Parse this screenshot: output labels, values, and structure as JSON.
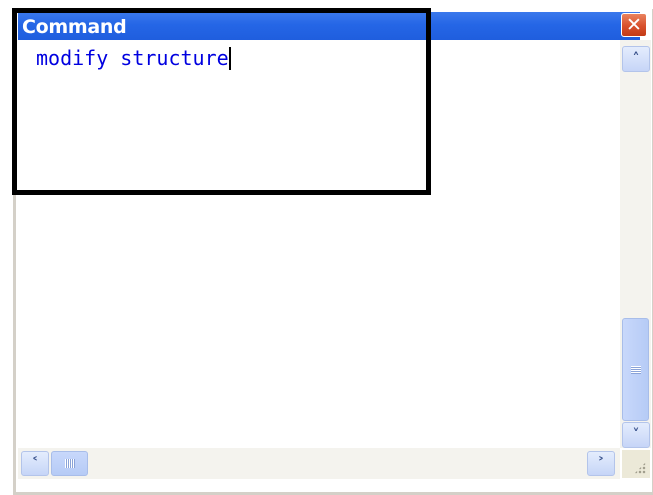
{
  "window": {
    "title": "Command",
    "close_glyph": "✕"
  },
  "editor": {
    "command_text": "modify structure"
  },
  "scrollbars": {
    "up_glyph": "˄",
    "down_glyph": "˅",
    "left_glyph": "˂",
    "right_glyph": "˃"
  },
  "colors": {
    "titlebar": "#2566e6",
    "command_text": "#0000e0",
    "close_button": "#d8502c",
    "annotation_border": "#000000"
  }
}
